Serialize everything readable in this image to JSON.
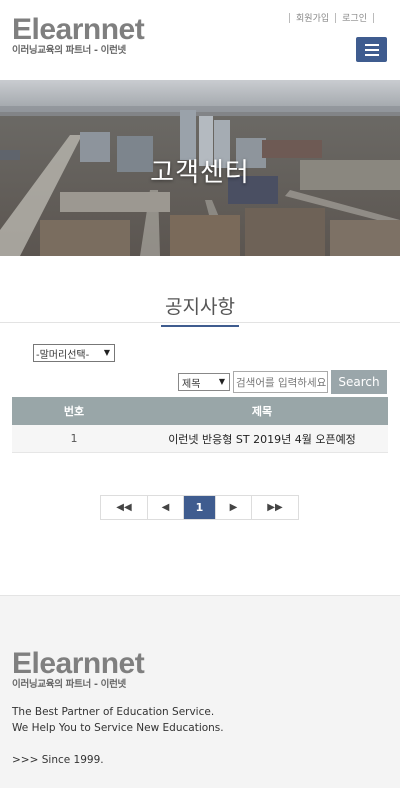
{
  "brand": {
    "name": "Elearnnet",
    "tagline": "이러닝교육의 파트너 - 이런넷"
  },
  "util_links": {
    "signup": "회원가입",
    "login": "로그인"
  },
  "hero": {
    "title": "고객센터"
  },
  "section": {
    "title": "공지사항"
  },
  "filters": {
    "header_select": "-말머리선택-",
    "search_field": "제목",
    "search_placeholder": "검색어를 입력하세요",
    "search_button": "Search"
  },
  "table": {
    "columns": [
      "번호",
      "제목"
    ],
    "rows": [
      {
        "num": "1",
        "title": "이런넷 반응형 ST 2019년 4월 오픈예정"
      }
    ]
  },
  "pagination": {
    "first": "◀◀",
    "prev": "◀",
    "current": "1",
    "next": "▶",
    "last": "▶▶"
  },
  "footer": {
    "line1": "The Best Partner of Education Service.",
    "line2": "We Help You to Service New Educations.",
    "since": ">>> Since 1999."
  },
  "colors": {
    "accent": "#3f5c8f",
    "table_header": "#99a6a8",
    "search_button": "#9aa6aa",
    "footer_bg": "#f4f4f4"
  }
}
